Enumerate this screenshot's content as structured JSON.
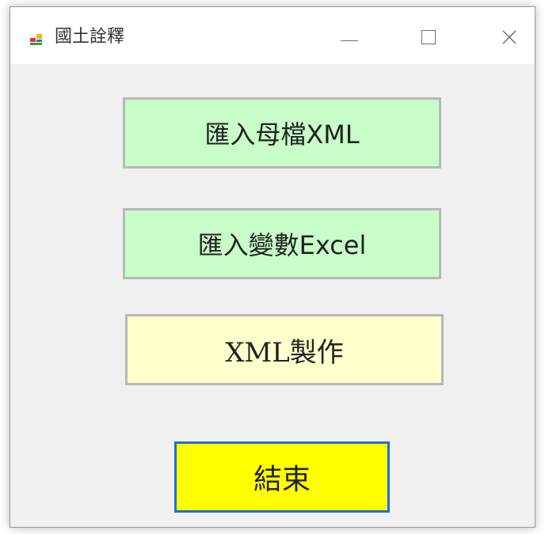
{
  "window": {
    "title": "國土詮釋",
    "icon": "app-form-icon",
    "controls": {
      "minimize_icon": "minimize-icon",
      "maximize_icon": "maximize-icon",
      "close_icon": "close-icon"
    }
  },
  "buttons": {
    "import_master_xml": "匯入母檔XML",
    "import_variables_excel": "匯入變數Excel",
    "make_xml": "XML製作",
    "end": "結束"
  },
  "colors": {
    "import_button_bg": "#c8fcc8",
    "make_button_bg": "#ffffcc",
    "end_button_bg": "#ffff00",
    "end_button_border": "#1f6fd0"
  }
}
